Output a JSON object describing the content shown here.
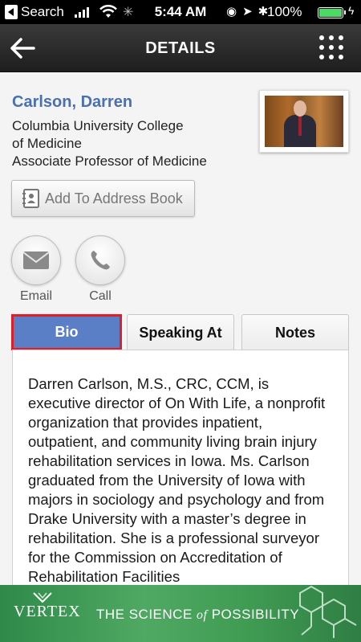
{
  "status_bar": {
    "back_app": "Search",
    "time": "5:44 AM",
    "battery_pct": "100%",
    "battery_level": 1.0
  },
  "nav": {
    "title": "DETAILS"
  },
  "person": {
    "name": "Carlson, Darren",
    "institution_line1": "Columbia University College",
    "institution_line2": "of Medicine",
    "title": "Associate Professor of Medicine"
  },
  "actions": {
    "add_to_address_book": "Add To Address Book",
    "email": "Email",
    "call": "Call"
  },
  "tabs": [
    {
      "label": "Bio",
      "active": true
    },
    {
      "label": "Speaking At",
      "active": false
    },
    {
      "label": "Notes",
      "active": false
    }
  ],
  "bio": {
    "text": "Darren Carlson, M.S., CRC, CCM, is executive director of On With Life, a nonprofit organization that provides inpatient, outpatient, and community living brain injury rehabilitation services in Iowa. Ms. Carlson graduated from the University of Iowa with majors in sociology and psychology and from Drake University with a master’s degree in rehabilitation. She is a professional surveyor for the Commission on Accreditation of Rehabilitation Facilities"
  },
  "banner": {
    "logo": "VERTEX",
    "tagline_pre": "THE SCIENCE ",
    "tagline_of": "of",
    "tagline_post": " POSSIBILITY"
  },
  "colors": {
    "name_blue": "#4a6fb3",
    "tab_active": "#5b7fc7",
    "tab_highlight": "#e01e2a",
    "banner_green": "#4fa962",
    "battery_green": "#4cd964"
  }
}
